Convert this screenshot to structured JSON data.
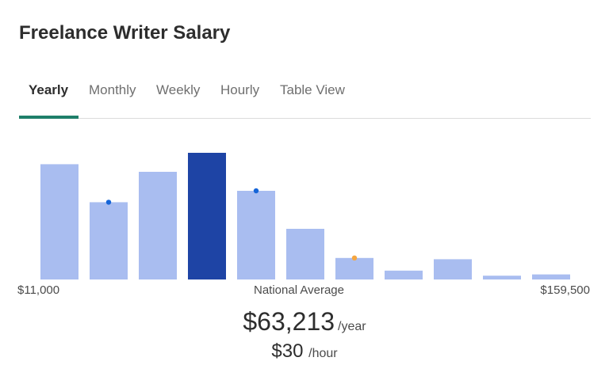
{
  "title": "Freelance Writer Salary",
  "tabs": [
    "Yearly",
    "Monthly",
    "Weekly",
    "Hourly",
    "Table View"
  ],
  "active_tab": 0,
  "colors": {
    "bar": "#a9bdf0",
    "bar_highlight": "#1e44a5",
    "marker_blue": "#1565d8",
    "marker_orange": "#f5a640",
    "tab_underline": "#1f7f6a"
  },
  "chart_data": {
    "type": "bar",
    "values": [
      91,
      61,
      85,
      100,
      70,
      40,
      17,
      7,
      16,
      3,
      4
    ],
    "highlight_index": 3,
    "markers": [
      {
        "index": 1,
        "value": 61,
        "color": "blue"
      },
      {
        "index": 4,
        "value": 70,
        "color": "blue"
      },
      {
        "index": 6,
        "value": 17,
        "color": "orange"
      }
    ],
    "x_range": [
      "$11,000",
      "$159,500"
    ],
    "x_mid_label": "National Average",
    "ylim": [
      0,
      100
    ]
  },
  "average": {
    "yearly": "$63,213",
    "yearly_unit": "/year",
    "hourly": "$30",
    "hourly_unit": "/hour"
  }
}
